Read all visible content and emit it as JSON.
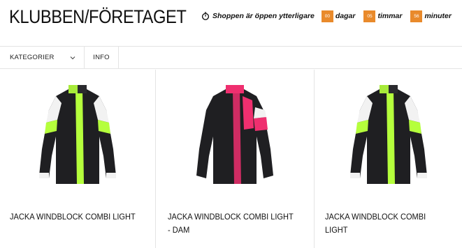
{
  "header": {
    "title": "KLUBBEN/FÖRETAGET"
  },
  "countdown": {
    "icon": "stopwatch-icon",
    "text": "Shoppen är öppen ytterligare",
    "days_value": "00",
    "days_label": "dagar",
    "hours_value": "05",
    "hours_label": "timmar",
    "minutes_value": "56",
    "minutes_label": "minuter",
    "accent_color": "#e98a2b"
  },
  "nav": {
    "categories_label": "KATEGORIER",
    "categories_icon": "chevron-down-icon",
    "info_label": "INFO"
  },
  "products": [
    {
      "name": "JACKA WINDBLOCK COMBI LIGHT",
      "accent_color": "#b5ff3c"
    },
    {
      "name": "JACKA WINDBLOCK COMBI LIGHT - DAM",
      "accent_color": "#ef2f6f"
    },
    {
      "name": "JACKA WINDBLOCK COMBI LIGHT",
      "accent_color": "#b5ff3c"
    }
  ]
}
